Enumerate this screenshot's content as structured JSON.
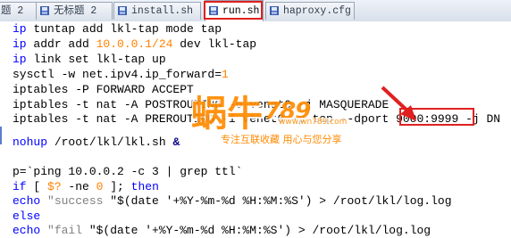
{
  "tabs": [
    {
      "label": "题 2",
      "icon": "document-icon",
      "active": false
    },
    {
      "label": "无标题 2",
      "icon": "document-icon",
      "active": false
    },
    {
      "label": "install.sh",
      "icon": "document-icon",
      "active": false
    },
    {
      "label": "run.sh",
      "icon": "document-icon",
      "active": true
    },
    {
      "label": "haproxy.cfg",
      "icon": "document-icon",
      "active": false
    }
  ],
  "code": {
    "l1": {
      "kw": "ip",
      "rest": " tuntap add lkl-tap mode tap"
    },
    "l2": {
      "kw": "ip",
      "a": " addr add ",
      "num": "10.0.0.1/24",
      "b": " dev lkl-tap"
    },
    "l3": {
      "kw": "ip",
      "rest": " link set lkl-tap up"
    },
    "l4": {
      "a": "sysctl -w net.ipv4.ip_forward=",
      "num": "1"
    },
    "l5": "iptables -P FORWARD ACCEPT",
    "l6": "iptables -t nat -A POSTROUTING -o venet0 -j MASQUERADE",
    "l7": {
      "a": "iptables -t nat -A PREROUTING -i venet0 -p tcp --dport ",
      "port": "9000:9999",
      "b": " -j DN"
    },
    "l8": {
      "a": "nohup",
      "b": " /root/lkl/lkl.sh ",
      "c": "&"
    },
    "l9": {
      "a": "p=`ping 10.0.0.2 -c 3 | grep ttl`"
    },
    "l10": {
      "kw1": "if",
      "a": " [ ",
      "var": "$?",
      "b": " -ne ",
      "num": "0",
      "c": " ]; ",
      "kw2": "then"
    },
    "l11": {
      "kw": "echo",
      "s1": " \"success ",
      "s2": "\"$(date '+%Y-%m-%d %H:%M:%S')",
      "rest": " > /root/lkl/log.log"
    },
    "l12": {
      "kw": "else"
    },
    "l13": {
      "kw": "echo",
      "s1": " \"fail ",
      "s2": "\"$(date '+%Y-%m-%d %H:%M:%S')",
      "rest": " > /root/lkl/log.log"
    }
  },
  "watermark": {
    "logo": "蜗牛",
    "number": "789",
    "url": "www.wn789.com",
    "slogan": "专注互联收藏  用心与您分享"
  },
  "colors": {
    "keyword": "#0000ff",
    "number": "#ff8000",
    "string": "#808080",
    "highlight_box": "#e02020",
    "watermark": "#ff8a00"
  }
}
